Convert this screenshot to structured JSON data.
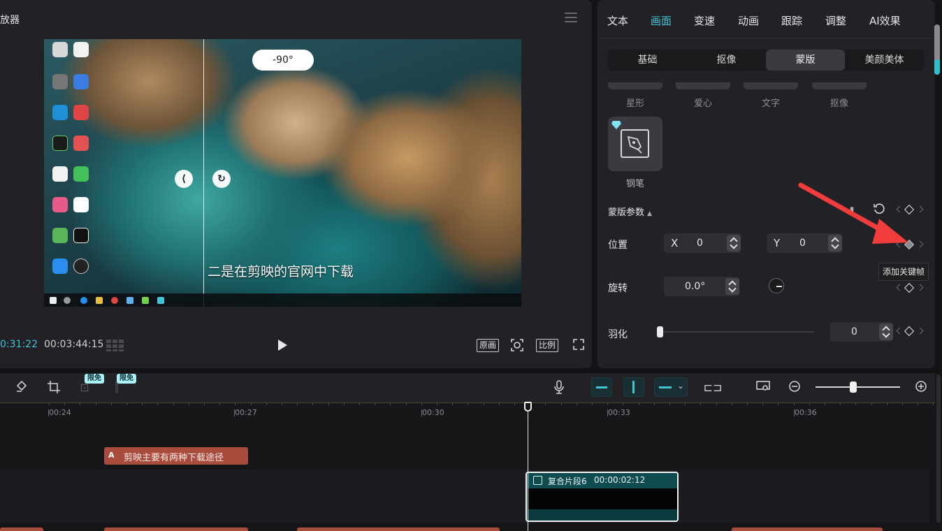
{
  "player": {
    "title": "放器",
    "rotation_label": "-90°",
    "subtitle": "二是在剪映的官网中下载",
    "current_time": "0:31:22",
    "duration": "00:03:44:15",
    "btn_original": "原画",
    "btn_ratio": "比例"
  },
  "panel": {
    "tabs": [
      "文本",
      "画面",
      "变速",
      "动画",
      "跟踪",
      "调整",
      "AI效果"
    ],
    "subtabs": [
      "基础",
      "抠像",
      "蒙版",
      "美颜美体"
    ],
    "shapes": [
      "星形",
      "爱心",
      "文字",
      "抠像"
    ],
    "pen_label": "钢笔",
    "section_title": "蒙版参数",
    "position_label": "位置",
    "x_prefix": "X",
    "x_value": "0",
    "y_prefix": "Y",
    "y_value": "0",
    "rotation_label": "旋转",
    "rotation_value": "0.0°",
    "feather_label": "羽化",
    "feather_value": "0",
    "tooltip": "添加关键帧"
  },
  "timeline": {
    "badge1": "限免",
    "badge2": "限免",
    "ticks": [
      "00:24",
      "00:27",
      "00:30",
      "00:33",
      "00:36"
    ],
    "text_clip_tag": "A",
    "text_clip_label": "剪映主要有两种下载途径",
    "compound_name": "复合片段6",
    "compound_duration": "00:00:02:12"
  },
  "colors": {
    "accent": "#3ec6d6",
    "panel_bg": "#222226",
    "clip_red": "#a84c3e",
    "clip_teal": "#0f4c50",
    "arrow_red": "#f03c3c"
  }
}
